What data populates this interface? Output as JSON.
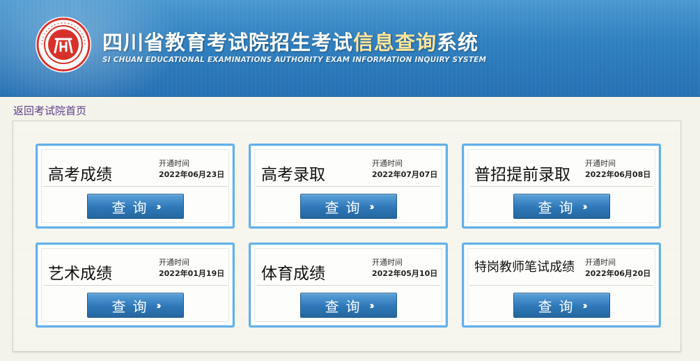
{
  "header": {
    "title_prefix": "四川省教育考试院招生考试",
    "title_highlight": "信息查询",
    "title_suffix": "系统",
    "subtitle": "SI CHUAN EDUCATIONAL EXAMINATIONS AUTHORITY EXAM INFORMATION INQUIRY SYSTEM",
    "logo_text": "四川省教育考试院"
  },
  "nav": {
    "back_link": "返回考试院首页"
  },
  "colors": {
    "header_blue": "#2f7fbf",
    "highlight_yellow": "#ffe59a",
    "card_border": "#63b0e8",
    "button_blue": "#2f77b8",
    "logo_red": "#d8312a"
  },
  "cards": [
    {
      "name": "高考成绩",
      "open_label": "开通时间",
      "open_date": "2022年06月23日",
      "button": "查询",
      "button_icon": "double-chevron-right-icon"
    },
    {
      "name": "高考录取",
      "open_label": "开通时间",
      "open_date": "2022年07月07日",
      "button": "查询",
      "button_icon": "double-chevron-right-icon"
    },
    {
      "name": "普招提前录取",
      "open_label": "开通时间",
      "open_date": "2022年06月08日",
      "button": "查询",
      "button_icon": "double-chevron-right-icon"
    },
    {
      "name": "艺术成绩",
      "open_label": "开通时间",
      "open_date": "2022年01月19日",
      "button": "查询",
      "button_icon": "double-chevron-right-icon"
    },
    {
      "name": "体育成绩",
      "open_label": "开通时间",
      "open_date": "2022年05月10日",
      "button": "查询",
      "button_icon": "double-chevron-right-icon"
    },
    {
      "name": "特岗教师笔试成绩",
      "open_label": "开通时间",
      "open_date": "2022年06月20日",
      "button": "查询",
      "button_icon": "double-chevron-right-icon"
    }
  ]
}
